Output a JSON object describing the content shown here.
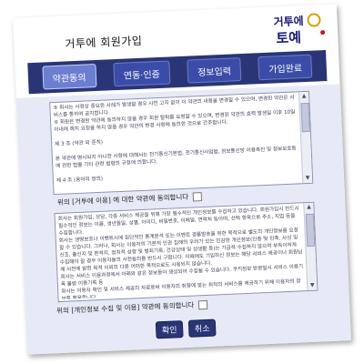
{
  "header": {
    "title": "거투에 회원가입",
    "logo_line1": "거투에",
    "logo_line2": "토예"
  },
  "nav": {
    "tabs": [
      {
        "label": "약관동의"
      },
      {
        "label": "연동·인증"
      },
      {
        "label": "정보입력"
      },
      {
        "label": "가입완료"
      }
    ]
  },
  "terms1": {
    "text": "⑤ 회사는 사정상 중요한 사례가 발생할 경우 사전 고지 없이 이 약관의 내용을 변경할 수 있으며, 변경된 약관은 서비스를 통하여 공지합니다.\n⑥ 회원은 변경된 약관에 동의하지 않을 경우 회원 탈퇴를 요청할 수 있으며, 변경된 약관의 효력 발생일 이후 10일 이내에 해지 요청을 하지 않을 경우 약관의 변경 사항에 동의한 것으로 간주합니다.\n\n제 3 조 (약관 외 준칙)\n\n본 약관에 명시되지 아니한 사항에 대해서는 전기통신기본법, 전기통신사업법, 정보통신망 이용촉진 및 정보보호등에 관한 법률 기타 관련 법령의 규정에 의합니다.\n\n제 4 조 (용어의 정의)"
  },
  "agree1": {
    "label": "위의 [거투에 이용] 에 대한 약관에 동의합니다"
  },
  "terms2": {
    "text": "회사는 회원가입, 상담, 각종 서비스 제공을 위해 가장 필수적인 개인정보를 수집하고 있습니다. 회원가입시 반드시 필수적인 정보는 이름, 생년월일, 성별, 아이디, 비밀번호, 이메일, 연락처 등이며, 선택 항목으로 주소, 직업 등을 수집합니다.\n회사는 생명보호나 이벤트시에 집단적인 통계분석 또는 이벤트 경품발송을 위한 목적으로 별도의 개인정보를 요청할 수 있습니다. 그러나, 회사는 이용자의 기본적 인권 침해의 우려가 있는 민감한 개인정보(인종 및 민족, 사상 및 신조, 출신지 및 본적지, 정치적 성향 및 범죄기록, 건강상태 및 성생활 등)는 가급적 수집하지 않으며 부득이하게 수집해야 할 경우 이용자들의 사전동의를 반드시 구합니다. 이때에도 기입하신 정보는 해당 서비스 제공이나 회원님께 사전에 밝힌 목적 이외의 다른 어떠한 목적으로도 사용되지 않습니다.\n회사는 서비스 이용과정에서 아래와 같은 정보들이 생성되어 수집될 수 있습니다. 쿠키정보 방문일시 서비스 이용기록 불량 이용기록 등\n회사는 이용자 확인 및 서비스 제공의 자료로써 이용자의 취향에 맞는 최적의 서비스를 제공하기 위해 이용자의 정보를 활용합니다."
  },
  "agree2": {
    "label": "위의 [개인정보 수집 및 이용] 약관에 동의합니다"
  },
  "buttons": {
    "confirm": "확인",
    "cancel": "취소"
  }
}
